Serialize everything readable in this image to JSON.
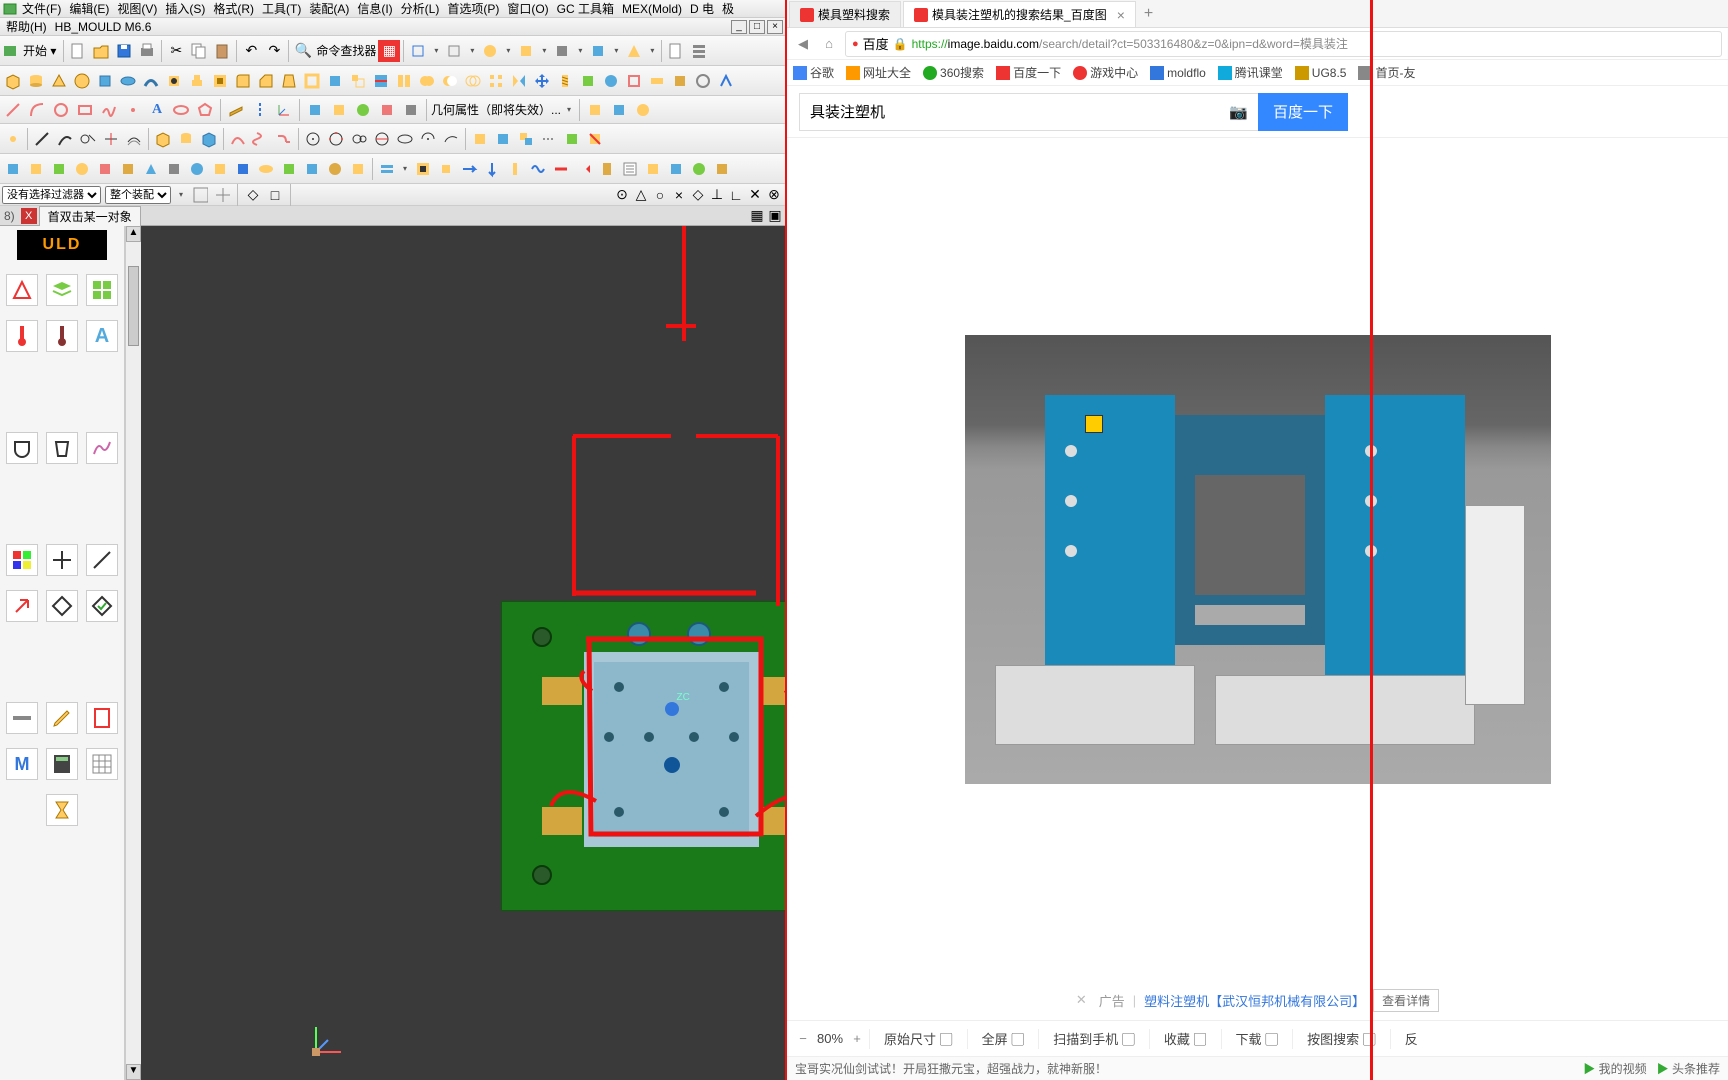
{
  "cad": {
    "menus": [
      "文件(F)",
      "编辑(E)",
      "视图(V)",
      "插入(S)",
      "格式(R)",
      "工具(T)",
      "装配(A)",
      "信息(I)",
      "分析(L)",
      "首选项(P)",
      "窗口(O)",
      "GC 工具箱",
      "MEX(Mold)",
      "D 电",
      "极"
    ],
    "help_row": [
      "帮助(H)",
      "HB_MOULD M6.6"
    ],
    "cmd_finder_label": "命令查找器",
    "geom_label": "几何属性（即将失效）...",
    "filter_no_sel": "没有选择过滤器",
    "filter_whole": "整个装配",
    "tab_label": "首双击某一对象",
    "status_label_8": "8)",
    "logo_text": "ULD",
    "zc_label": "ZC"
  },
  "browser": {
    "tab_inactive": "模具塑料搜索",
    "tab_active": "模具装注塑机的搜索结果_百度图",
    "baidu_label": "百度",
    "url_green": "https://",
    "url_host": "image.baidu.com",
    "url_rest": "/search/detail?ct=503316480&z=0&ipn=d&word=模具装注",
    "bookmarks": [
      {
        "icon": "#4285f4",
        "label": "谷歌"
      },
      {
        "icon": "#f90",
        "label": "网址大全"
      },
      {
        "icon": "#2a2",
        "label": "360搜索"
      },
      {
        "icon": "#e33",
        "label": "百度一下"
      },
      {
        "icon": "#e33",
        "label": "游戏中心"
      },
      {
        "icon": "#37d",
        "label": "moldflo"
      },
      {
        "icon": "#1ad",
        "label": "腾讯课堂"
      },
      {
        "icon": "#c90",
        "label": "UG8.5"
      },
      {
        "icon": "#888",
        "label": "首页-友"
      }
    ],
    "search_value": "具装注塑机",
    "search_btn": "百度一下",
    "ad_label": "广告",
    "caption_link": "塑料注塑机【武汉恒邦机械有限公司】",
    "detail_btn": "查看详情",
    "zoom": "80%",
    "bottom_items": [
      "原始尺寸 ▢",
      "全屏 ▢",
      "扫描到手机 ▢",
      "收藏 ▢",
      "下载 ▢",
      "按图搜索 ▢",
      "反"
    ],
    "ticker": "宝哥实况仙剑试试！开局狂撒元宝，超强战力，就神新服！",
    "ticker_items": [
      "我的视频",
      "头条推荐"
    ]
  }
}
